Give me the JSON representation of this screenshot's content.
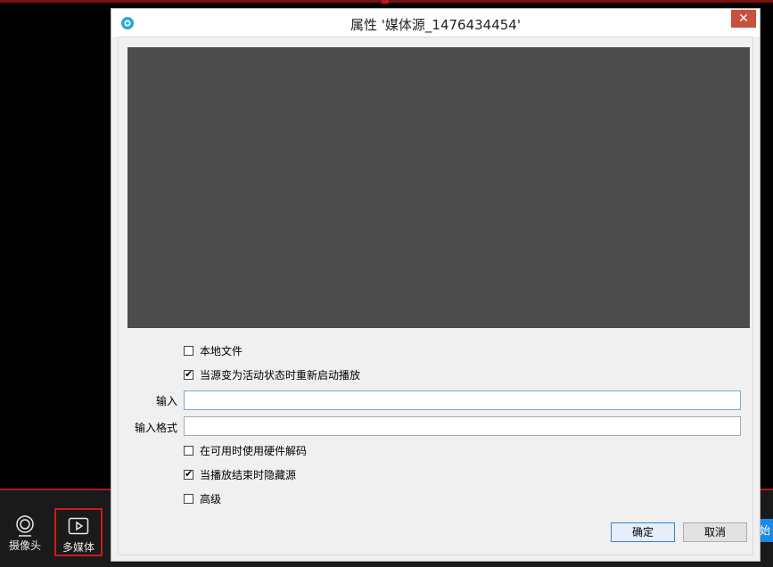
{
  "dialog": {
    "title": "属性 '媒体源_1476434454'",
    "close_glyph": "✕",
    "options": [
      {
        "label": "本地文件",
        "checked": false
      },
      {
        "label": "当源变为活动状态时重新启动播放",
        "checked": true
      }
    ],
    "input_label": "输入",
    "input_value": "",
    "input_format_label": "输入格式",
    "input_format_value": "",
    "options2": [
      {
        "label": "在可用时使用硬件解码",
        "checked": false
      },
      {
        "label": "当播放结束时隐藏源",
        "checked": true
      },
      {
        "label": "高级",
        "checked": false
      }
    ],
    "ok_label": "确定",
    "cancel_label": "取消"
  },
  "dock": {
    "camera_label": "摄像头",
    "media_label": "多媒体",
    "right_edge_text": "始"
  },
  "colors": {
    "accent_red": "#d01818",
    "preview_bg": "#4c4c4c",
    "close_red": "#c7503f",
    "edge_blue": "#1e88e5"
  },
  "icons": [
    "app-logo-icon",
    "close-icon",
    "camera-icon",
    "play-media-icon",
    "checkmark-icon"
  ]
}
